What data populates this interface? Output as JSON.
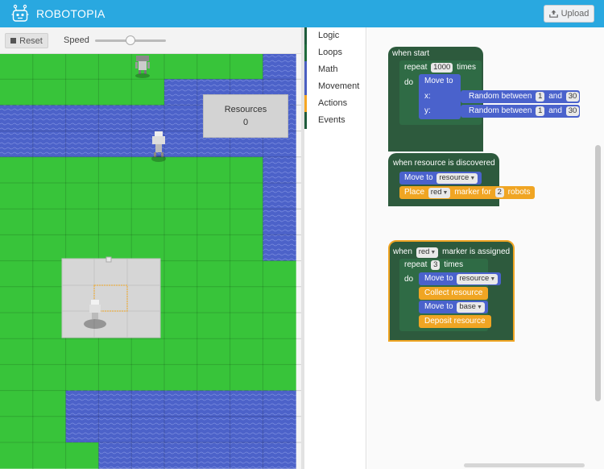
{
  "app": {
    "title": "ROBOTOPIA",
    "upload_label": "Upload",
    "upload_icon": "upload-icon",
    "logo_icon": "robot-logo-icon"
  },
  "toolbar": {
    "reset_label": "Reset",
    "speed_label": "Speed",
    "speed_value_fraction": 0.5
  },
  "resources": {
    "label": "Resources",
    "value": "0"
  },
  "categories": [
    {
      "label": "Logic",
      "color": "#1f5b3c"
    },
    {
      "label": "Loops",
      "color": "#1f6b3c"
    },
    {
      "label": "Math",
      "color": "#4a5fc1"
    },
    {
      "label": "Movement",
      "color": "#4a5fc1"
    },
    {
      "label": "Actions",
      "color": "#f5a623"
    },
    {
      "label": "Events",
      "color": "#1f5b3c"
    }
  ],
  "colors": {
    "header": "#29a8e0",
    "grass": "#38c43a",
    "water": "#4c62c9",
    "events_block": "#2d5a3d",
    "loop_block": "#2f6b45",
    "move_block": "#4a62cc",
    "action_block": "#f0a523",
    "selected_outline": "#f0a523"
  },
  "blocks": {
    "when_start": {
      "hat_label": "when start",
      "repeat_prefix": "repeat",
      "repeat_count": "1000",
      "repeat_suffix": "times",
      "do_label": "do",
      "move_to_label": "Move to",
      "x_label": "x:",
      "y_label": "y:",
      "random_label": "Random between",
      "rand_min": "1",
      "and_label": "and",
      "rand_max": "30"
    },
    "resource_discovered": {
      "hat_label": "when resource is discovered",
      "move_to_label": "Move to",
      "target": "resource",
      "place_label": "Place",
      "marker_color": "red",
      "marker_for_label": "marker for",
      "robot_count": "2",
      "robots_label": "robots"
    },
    "marker_assigned": {
      "when_label": "when",
      "marker_color": "red",
      "assigned_label": "marker is assigned",
      "repeat_prefix": "repeat",
      "repeat_count": "3",
      "repeat_suffix": "times",
      "do_label": "do",
      "move_to_label": "Move to",
      "target_resource": "resource",
      "collect_label": "Collect resource",
      "target_base": "base",
      "deposit_label": "Deposit resource"
    }
  }
}
